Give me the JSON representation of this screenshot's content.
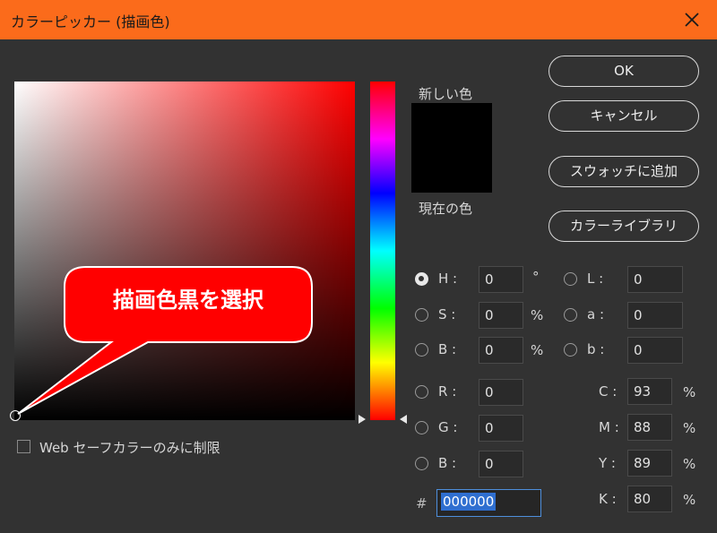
{
  "window": {
    "title": "カラーピッカー (描画色)"
  },
  "labels": {
    "new_color": "新しい色",
    "current_color": "現在の色",
    "web_safe": "Web セーフカラーのみに制限",
    "hash": "#"
  },
  "buttons": {
    "ok": "OK",
    "cancel": "キャンセル",
    "add_swatch": "スウォッチに追加",
    "library": "カラーライブラリ"
  },
  "hsb": {
    "h": {
      "label": "H :",
      "value": "0",
      "unit": "°"
    },
    "s": {
      "label": "S :",
      "value": "0",
      "unit": "%"
    },
    "b": {
      "label": "B :",
      "value": "0",
      "unit": "%"
    }
  },
  "rgb": {
    "r": {
      "label": "R :",
      "value": "0"
    },
    "g": {
      "label": "G :",
      "value": "0"
    },
    "b": {
      "label": "B :",
      "value": "0"
    }
  },
  "lab": {
    "l": {
      "label": "L :",
      "value": "0"
    },
    "a": {
      "label": "a :",
      "value": "0"
    },
    "b": {
      "label": "b :",
      "value": "0"
    }
  },
  "cmyk": {
    "c": {
      "label": "C :",
      "value": "93",
      "unit": "%"
    },
    "m": {
      "label": "M :",
      "value": "88",
      "unit": "%"
    },
    "y": {
      "label": "Y :",
      "value": "89",
      "unit": "%"
    },
    "k": {
      "label": "K :",
      "value": "80",
      "unit": "%"
    }
  },
  "hex": "000000",
  "callout": "描画色黒を選択",
  "colors": {
    "title_bar": "#fb6b1b",
    "background": "#323232",
    "callout": "#ff0000",
    "new_swatch": "#000000"
  },
  "state": {
    "selected_mode": "H",
    "web_safe_only": false
  }
}
